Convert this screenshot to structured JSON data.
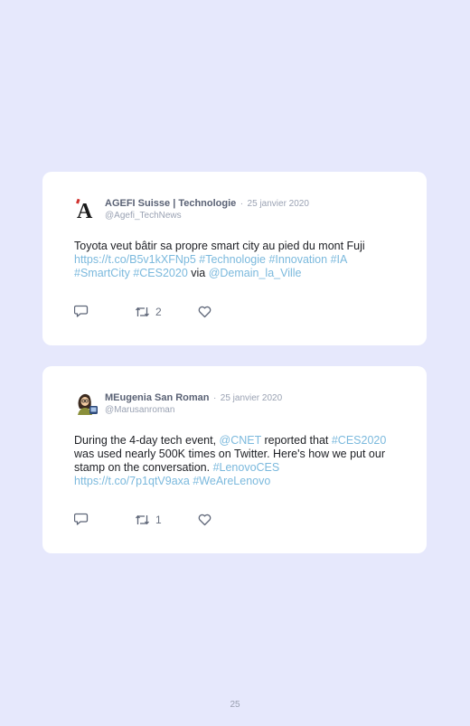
{
  "tweets": [
    {
      "name": "AGEFI Suisse | Technologie",
      "separator": "·",
      "date": "25 janvier 2020",
      "handle": "@Agefi_TechNews",
      "text_segments": [
        {
          "text": "Toyota veut bâtir sa propre smart city au pied du mont Fuji ",
          "link": false
        },
        {
          "text": "https://t.co/B5v1kXFNp5",
          "link": true
        },
        {
          "text": " ",
          "link": false
        },
        {
          "text": "#Technologie",
          "link": true
        },
        {
          "text": " ",
          "link": false
        },
        {
          "text": "#Innovation",
          "link": true
        },
        {
          "text": " ",
          "link": false
        },
        {
          "text": "#IA",
          "link": true
        },
        {
          "text": " ",
          "link": false
        },
        {
          "text": "#SmartCity",
          "link": true
        },
        {
          "text": " ",
          "link": false
        },
        {
          "text": "#CES2020",
          "link": true
        },
        {
          "text": " via ",
          "link": false
        },
        {
          "text": "@Demain_la_Ville",
          "link": true
        }
      ],
      "retweets": "2"
    },
    {
      "name": "MEugenia San Roman",
      "separator": "·",
      "date": "25 janvier 2020",
      "handle": "@Marusanroman",
      "text_segments": [
        {
          "text": "During the 4-day tech event, ",
          "link": false
        },
        {
          "text": "@CNET",
          "link": true
        },
        {
          "text": " reported that ",
          "link": false
        },
        {
          "text": "#CES2020",
          "link": true
        },
        {
          "text": " was used nearly 500K times on Twitter. Here's how we put our stamp on the conversation. ",
          "link": false
        },
        {
          "text": "#LenovoCES",
          "link": true
        },
        {
          "text": " ",
          "link": false
        },
        {
          "text": "https://t.co/7p1qtV9axa",
          "link": true
        },
        {
          "text": " ",
          "link": false
        },
        {
          "text": "#WeAreLenovo",
          "link": true
        }
      ],
      "retweets": "1"
    }
  ],
  "page_number": "25",
  "logo_letter": "A",
  "colors": {
    "background": "#e6e8fc",
    "link": "#7bb9dd",
    "logo_accent": "#d0312d"
  }
}
